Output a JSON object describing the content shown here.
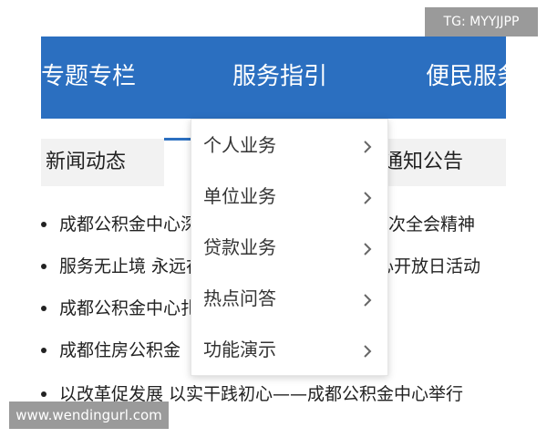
{
  "nav": {
    "items": [
      "专题专栏",
      "服务指引",
      "便民服务"
    ]
  },
  "sections": {
    "left_title": "新闻动态",
    "right_title": "通知公告"
  },
  "news": [
    "成都公积金中心深入学习贯彻党的十九届十次全会精神",
    "服务无止境 永远在路上——成都公积金中心开放日活动",
    "成都公积金中心扎实开展党史学习教育工作",
    "成都住房公积金",
    "以改革促发展 以实干践初心——成都公积金中心举行"
  ],
  "dropdown": {
    "items": [
      "个人业务",
      "单位业务",
      "贷款业务",
      "热点问答",
      "功能演示"
    ]
  },
  "watermarks": {
    "top": "TG: MYYJJPP",
    "bottom": "www.wendingurl.com"
  },
  "colors": {
    "nav_background": "#2b6fc0",
    "section_background": "#f2f2f2",
    "watermark_background": "#9a9a9a"
  }
}
